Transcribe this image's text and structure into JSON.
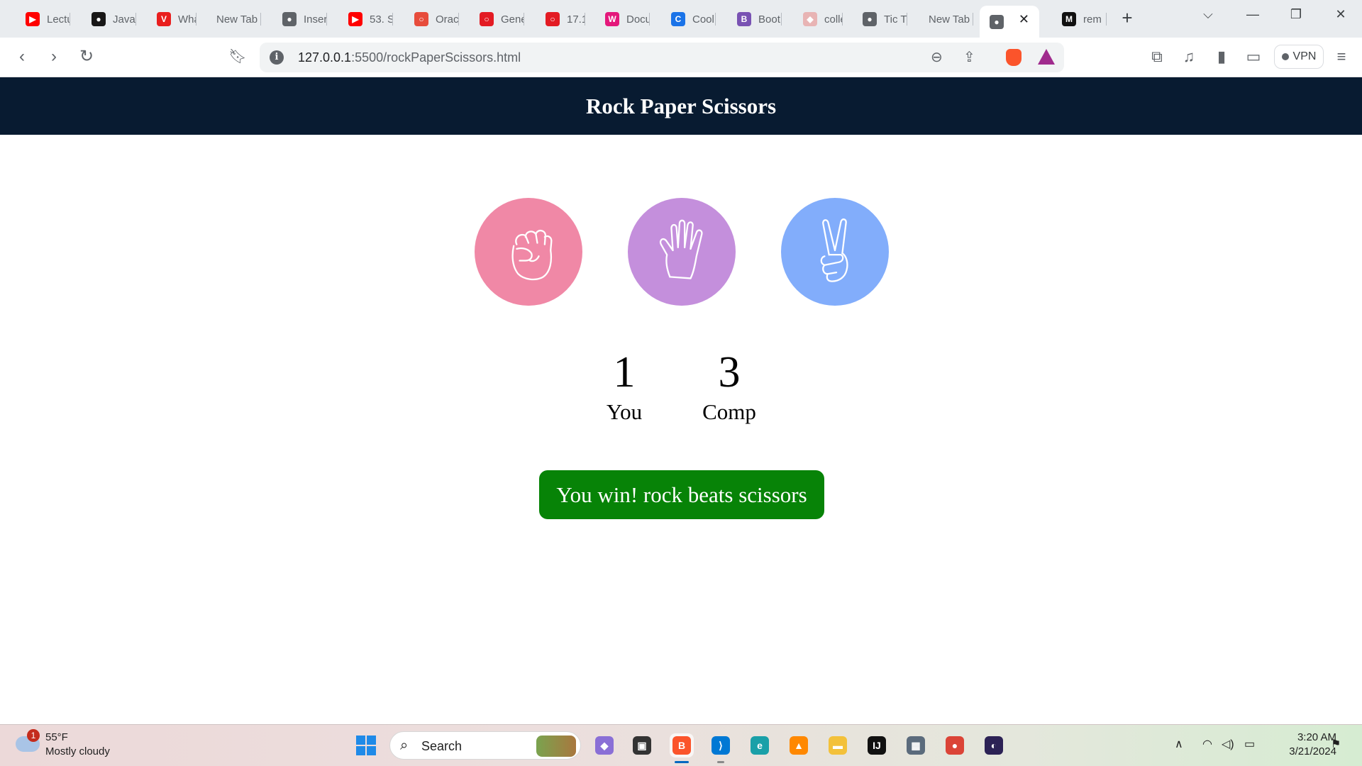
{
  "browser": {
    "tabs": [
      {
        "title": "Lectu",
        "icon": "youtube-icon",
        "color": "#ff0000",
        "glyph": "▶"
      },
      {
        "title": "Java",
        "icon": "github-icon",
        "color": "#181717",
        "glyph": "●"
      },
      {
        "title": "Wha",
        "icon": "brand-v-icon",
        "color": "#e91e1e",
        "glyph": "V"
      },
      {
        "title": "New Tab",
        "icon": "",
        "color": "",
        "glyph": ""
      },
      {
        "title": "Inser",
        "icon": "globe-icon",
        "color": "#5f6368",
        "glyph": "●"
      },
      {
        "title": "53. S",
        "icon": "youtube-icon",
        "color": "#ff0000",
        "glyph": "▶"
      },
      {
        "title": "Orac",
        "icon": "oracle-icon",
        "color": "#e74c3c",
        "glyph": "○"
      },
      {
        "title": "Gene",
        "icon": "oracle-icon",
        "color": "#e31b23",
        "glyph": "○"
      },
      {
        "title": "17.1",
        "icon": "oracle-icon",
        "color": "#e31b23",
        "glyph": "○"
      },
      {
        "title": "Docu",
        "icon": "w-icon",
        "color": "#e4187b",
        "glyph": "W"
      },
      {
        "title": "Cool",
        "icon": "c-icon",
        "color": "#1a73e8",
        "glyph": "C"
      },
      {
        "title": "Boot",
        "icon": "bootstrap-icon",
        "color": "#7952b3",
        "glyph": "B"
      },
      {
        "title": "colle",
        "icon": "brave-shield-icon",
        "color": "#e8b4b4",
        "glyph": "◆"
      },
      {
        "title": "Tic T",
        "icon": "globe-icon",
        "color": "#5f6368",
        "glyph": "●"
      },
      {
        "title": "New Tab",
        "icon": "",
        "color": "",
        "glyph": ""
      },
      {
        "title": "",
        "icon": "globe-icon",
        "color": "#5f6368",
        "glyph": "●",
        "active": true
      },
      {
        "title": "rem",
        "icon": "m-icon",
        "color": "#111111",
        "glyph": "M"
      }
    ],
    "url_host": "127.0.0.1",
    "url_rest": ":5500/rockPaperScissors.html",
    "vpn_label": "VPN"
  },
  "page": {
    "title": "Rock Paper Scissors",
    "header_color": "#081b31",
    "choices": [
      {
        "name": "rock",
        "icon": "fist-icon",
        "color": "#f088a6"
      },
      {
        "name": "paper",
        "icon": "open-hand-icon",
        "color": "#c48fdc"
      },
      {
        "name": "scissors",
        "icon": "peace-hand-icon",
        "color": "#82adfb"
      }
    ],
    "scores": {
      "user": {
        "value": "1",
        "label": "You"
      },
      "comp": {
        "value": "3",
        "label": "Comp"
      }
    },
    "message": {
      "text": "You win! rock beats scissors",
      "color": "#078307"
    }
  },
  "taskbar": {
    "weather_badge": "1",
    "weather_temp": "55°F",
    "weather_desc": "Mostly cloudy",
    "search_label": "Search",
    "time": "3:20 AM",
    "date": "3/21/2024",
    "apps": [
      {
        "name": "copilot-icon",
        "color": "#8a6fd6",
        "glyph": "◆"
      },
      {
        "name": "task-view-icon",
        "color": "#333333",
        "glyph": "▣"
      },
      {
        "name": "brave-icon",
        "color": "#fb542b",
        "glyph": "B",
        "active": true
      },
      {
        "name": "vscode-icon",
        "color": "#0078d4",
        "glyph": "⟩",
        "active": true
      },
      {
        "name": "edge-icon",
        "color": "#1aa0a8",
        "glyph": "e"
      },
      {
        "name": "vlc-icon",
        "color": "#ff8800",
        "glyph": "▲"
      },
      {
        "name": "file-explorer-icon",
        "color": "#f3c13a",
        "glyph": "▬"
      },
      {
        "name": "intellij-icon",
        "color": "#111111",
        "glyph": "IJ"
      },
      {
        "name": "calculator-icon",
        "color": "#5b6b7c",
        "glyph": "▦"
      },
      {
        "name": "chrome-icon",
        "color": "#db4437",
        "glyph": "●"
      },
      {
        "name": "eclipse-icon",
        "color": "#2c2255",
        "glyph": "◐"
      }
    ]
  }
}
